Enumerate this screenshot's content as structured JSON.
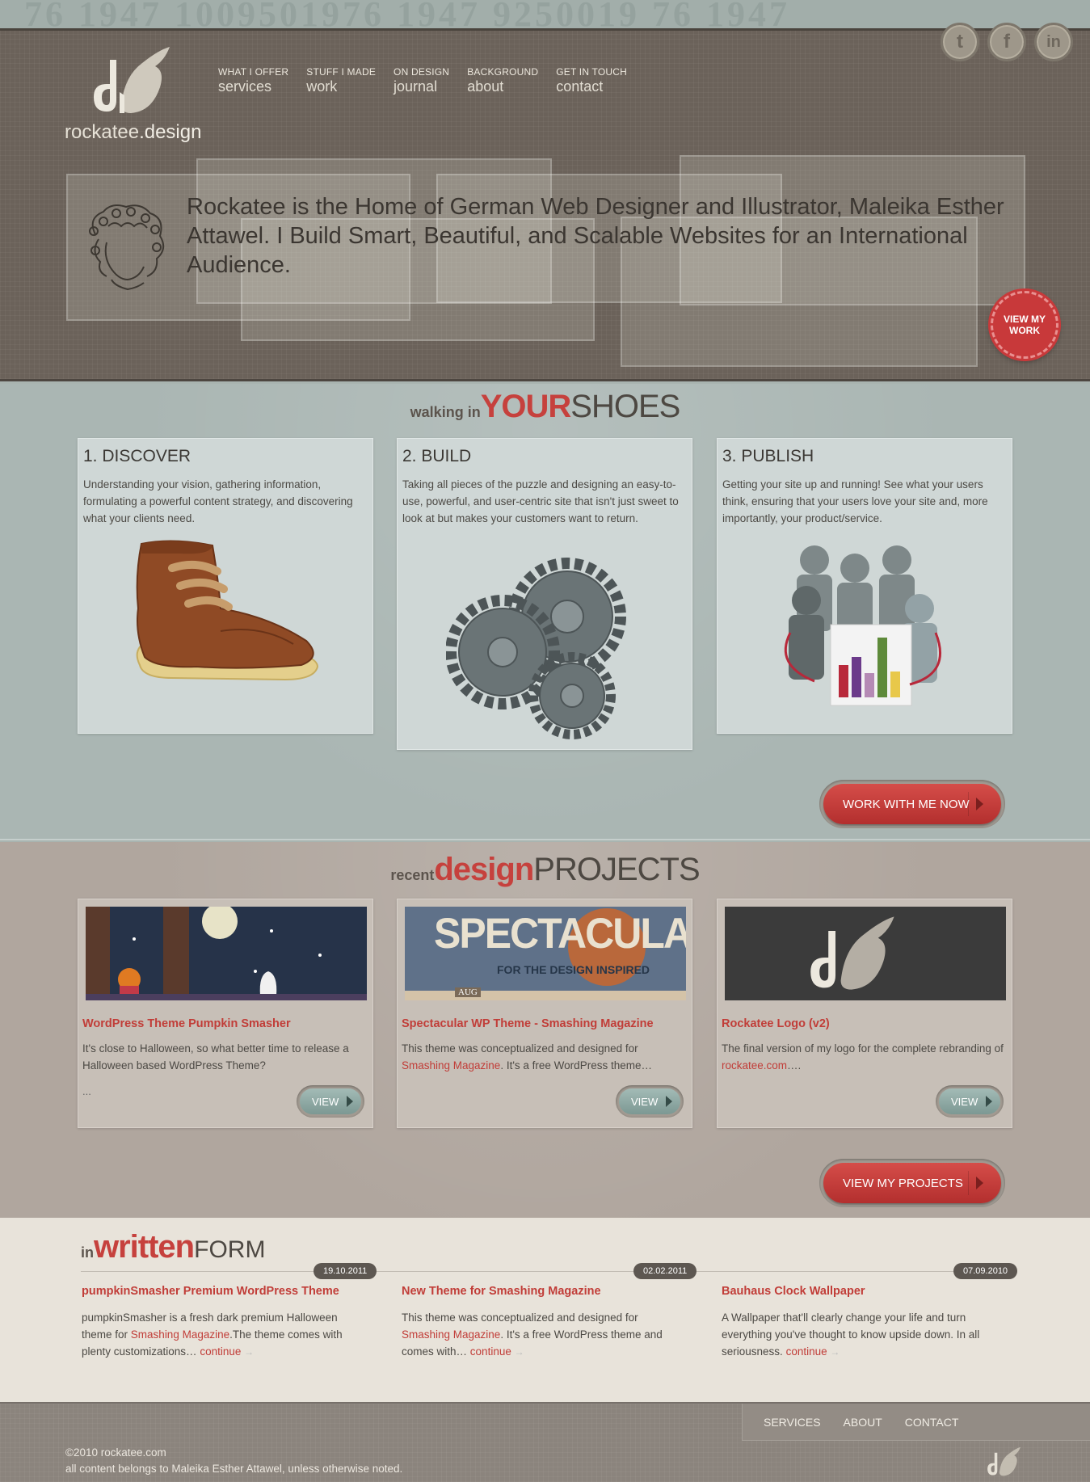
{
  "top_strip": {
    "digits": "76 1947 1009501976 1947 9250019 76 1947"
  },
  "logo": {
    "name": "rockatee",
    "suffix": ".design"
  },
  "nav": [
    {
      "small": "WHAT I OFFER",
      "big": "services"
    },
    {
      "small": "STUFF I MADE",
      "big": "work"
    },
    {
      "small": "ON DESIGN",
      "big": "journal"
    },
    {
      "small": "BACKGROUND",
      "big": "about"
    },
    {
      "small": "GET IN TOUCH",
      "big": "contact"
    }
  ],
  "social": [
    {
      "icon": "twitter-icon",
      "glyph": "t"
    },
    {
      "icon": "facebook-icon",
      "glyph": "f"
    },
    {
      "icon": "linkedin-icon",
      "glyph": "in"
    }
  ],
  "hero": {
    "text": "Rockatee is the Home of German Web Designer and Illustrator, Maleika Esther Attawel. I Build Smart, Beautiful, and Scalable Websites for an International Audience.",
    "button": "VIEW MY WORK"
  },
  "walking": {
    "pre": "walking in",
    "mid": "YOUR",
    "post": "SHOES",
    "steps": [
      {
        "title": "1. DISCOVER",
        "text": "Understanding your vision, gathering information, formulating a powerful content strategy, and discovering what your clients need.",
        "icon": "shoe-icon"
      },
      {
        "title": "2. BUILD",
        "text": "Taking all pieces of the puzzle and designing an easy-to-use, powerful, and user-centric site that isn't just sweet to look at but makes your customers want to return.",
        "icon": "gears-icon"
      },
      {
        "title": "3. PUBLISH",
        "text": "Getting your site up and running! See what your users think, ensuring that your users love your site and, more importantly, your product/service.",
        "icon": "audience-chart-icon"
      }
    ],
    "cta": "WORK WITH ME NOW"
  },
  "projects": {
    "pre": "recent",
    "mid": "design",
    "post": "PROJECTS",
    "thumb_texts": {
      "spectacular": "SPECTACULAR",
      "spectacular_sub": "FOR THE DESIGN INSPIRED",
      "month": "AUG"
    },
    "items": [
      {
        "title": "WordPress Theme Pumpkin Smasher",
        "text": "It's close to Halloween, so what better time to release a Halloween based WordPress Theme?",
        "ellipsis": "...",
        "view": "VIEW"
      },
      {
        "title": "Spectacular WP Theme - Smashing Magazine",
        "text_before": "This theme was conceptualized and designed for",
        "link": "Smashing Magazine",
        "text_after": ". It's a free WordPress theme…",
        "view": "VIEW"
      },
      {
        "title": "Rockatee Logo (v2)",
        "text_before": "The final version of my logo for the complete rebranding of",
        "link": "rockatee.com",
        "text_after": "….",
        "view": "VIEW"
      }
    ],
    "cta": "VIEW MY PROJECTS"
  },
  "written": {
    "pre": "in",
    "mid": "written",
    "post": "FORM",
    "posts": [
      {
        "date": "19.10.2011",
        "title": "pumpkinSmasher Premium WordPress Theme",
        "text_before": "pumpkinSmasher is a fresh dark premium Halloween theme for",
        "link": "Smashing Magazine",
        "text_after": ".The theme comes with plenty customizations…",
        "more": "continue"
      },
      {
        "date": "02.02.2011",
        "title": "New Theme for Smashing Magazine",
        "text_before": "This theme was conceptualized and designed for",
        "link": "Smashing Magazine",
        "text_after": ". It's a free WordPress theme and comes with…",
        "more": "continue"
      },
      {
        "date": "07.09.2010",
        "title": "Bauhaus Clock Wallpaper",
        "text_before": "A Wallpaper that'll clearly change your life and turn everything you've thought to know upside down. In all seriousness.",
        "link": "",
        "text_after": "",
        "more": "continue"
      }
    ]
  },
  "footer": {
    "nav": [
      "SERVICES",
      "ABOUT",
      "CONTACT"
    ],
    "copyright": "©2010 rockatee.com",
    "rights": "all content belongs to Maleika Esther Attawel, unless otherwise noted."
  },
  "colors": {
    "accent": "#c13d38",
    "header_bg": "#6b625a",
    "section_blue": "#aab6b3",
    "section_taupe": "#b0a69e",
    "section_cream": "#e8e3da",
    "footer_bg": "#8b847d"
  }
}
